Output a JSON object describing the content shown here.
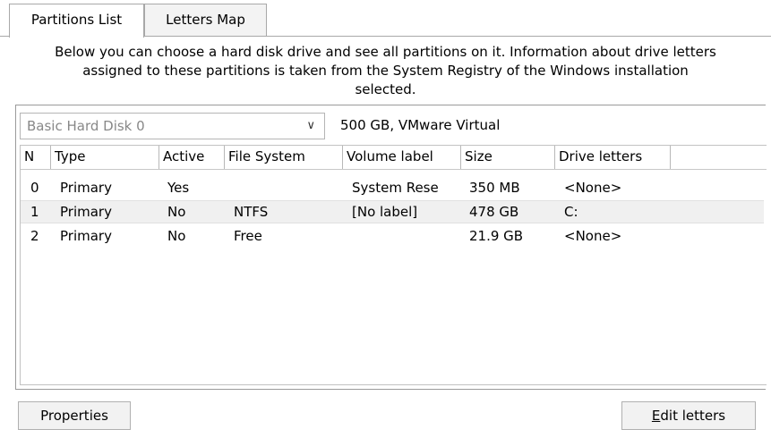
{
  "tabs": [
    {
      "label": "Partitions List",
      "active": true
    },
    {
      "label": "Letters Map",
      "active": false
    }
  ],
  "description": {
    "line1": "Below you can choose a hard disk drive and see all partitions on it. Information about drive letters",
    "line2": "assigned to these partitions is taken from the System Registry of the Windows installation",
    "line3": "selected."
  },
  "disk": {
    "selected": "Basic Hard Disk 0",
    "info": "500 GB, VMware Virtual"
  },
  "table": {
    "headers": [
      "N",
      "Type",
      "Active",
      "File System",
      "Volume label",
      "Size",
      "Drive letters"
    ],
    "rows": [
      [
        "0",
        "Primary",
        "Yes",
        "",
        "System Rese",
        "350 MB",
        "<None>"
      ],
      [
        "1",
        "Primary",
        "No",
        "NTFS",
        "[No label]",
        "478 GB",
        "C:"
      ],
      [
        "2",
        "Primary",
        "No",
        "Free",
        "",
        "21.9 GB",
        "<None>"
      ]
    ],
    "selected_row": 1
  },
  "buttons": {
    "properties": "Properties",
    "edit_letters_mnemonic": "E",
    "edit_letters_rest": "dit letters"
  }
}
